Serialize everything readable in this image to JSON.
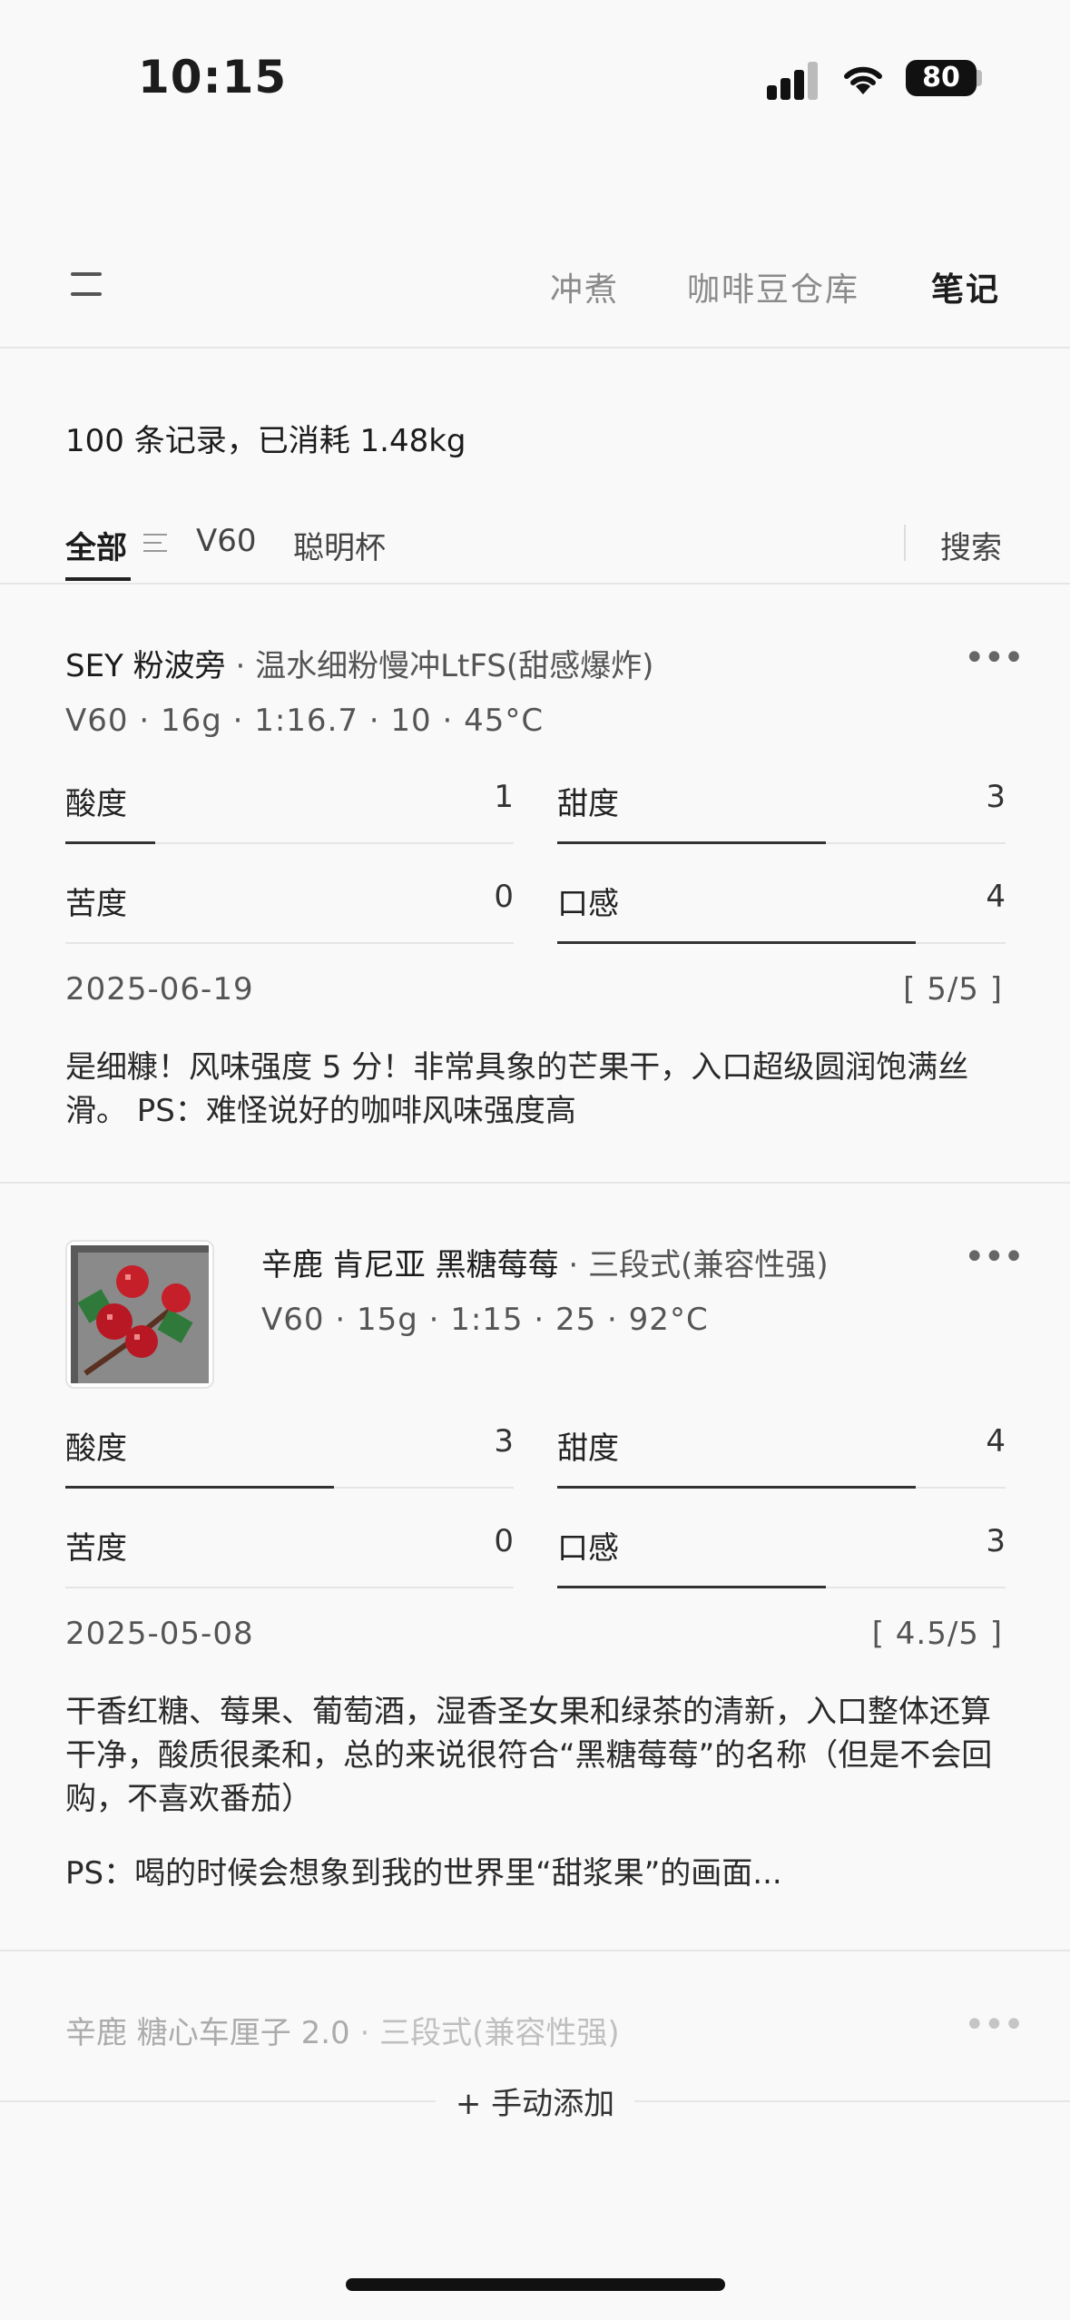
{
  "status": {
    "time": "10:15",
    "battery": "80"
  },
  "nav": {
    "tabs": [
      {
        "label": "冲煮",
        "active": false
      },
      {
        "label": "咖啡豆仓库",
        "active": false
      },
      {
        "label": "笔记",
        "active": true
      }
    ]
  },
  "summary": "100 条记录，已消耗 1.48kg",
  "filters": {
    "all": "全部",
    "items": [
      "V60",
      "聪明杯"
    ],
    "search": "搜索"
  },
  "entries": [
    {
      "bean": "SEY 粉波旁",
      "method": "温水细粉慢冲LtFS(甜感爆炸)",
      "params": "V60 · 16g · 1:16.7 · 10 · 45°C",
      "metrics": [
        {
          "label": "酸度",
          "value": 1
        },
        {
          "label": "甜度",
          "value": 3
        },
        {
          "label": "苦度",
          "value": 0
        },
        {
          "label": "口感",
          "value": 4
        }
      ],
      "date": "2025-06-19",
      "rating": "[ 5/5 ]",
      "notes": "是细糠！风味强度 5 分！非常具象的芒果干，入口超级圆润饱满丝滑。 PS：难怪说好的咖啡风味强度高"
    },
    {
      "bean": "辛鹿 肯尼亚 黑糖莓莓",
      "method": "三段式(兼容性强)",
      "params": "V60 · 15g · 1:15 · 25 · 92°C",
      "metrics": [
        {
          "label": "酸度",
          "value": 3
        },
        {
          "label": "甜度",
          "value": 4
        },
        {
          "label": "苦度",
          "value": 0
        },
        {
          "label": "口感",
          "value": 3
        }
      ],
      "date": "2025-05-08",
      "rating": "[ 4.5/5 ]",
      "notes": "干香红糖、莓果、葡萄酒，湿香圣女果和绿茶的清新，入口整体还算干净，酸质很柔和，总的来说很符合“黑糖莓莓”的名称（但是不会回购，不喜欢番茄）",
      "notes_ps": "PS：喝的时候会想象到我的世界里“甜浆果”的画面..."
    },
    {
      "bean": "辛鹿 糖心车厘子 2.0",
      "method": "三段式(兼容性强)"
    }
  ],
  "metric_max": 5,
  "add_button": "+ 手动添加",
  "colors": {
    "background": "#f9f9f9",
    "text": "#1c1c1c",
    "muted": "#8a8a8a"
  }
}
